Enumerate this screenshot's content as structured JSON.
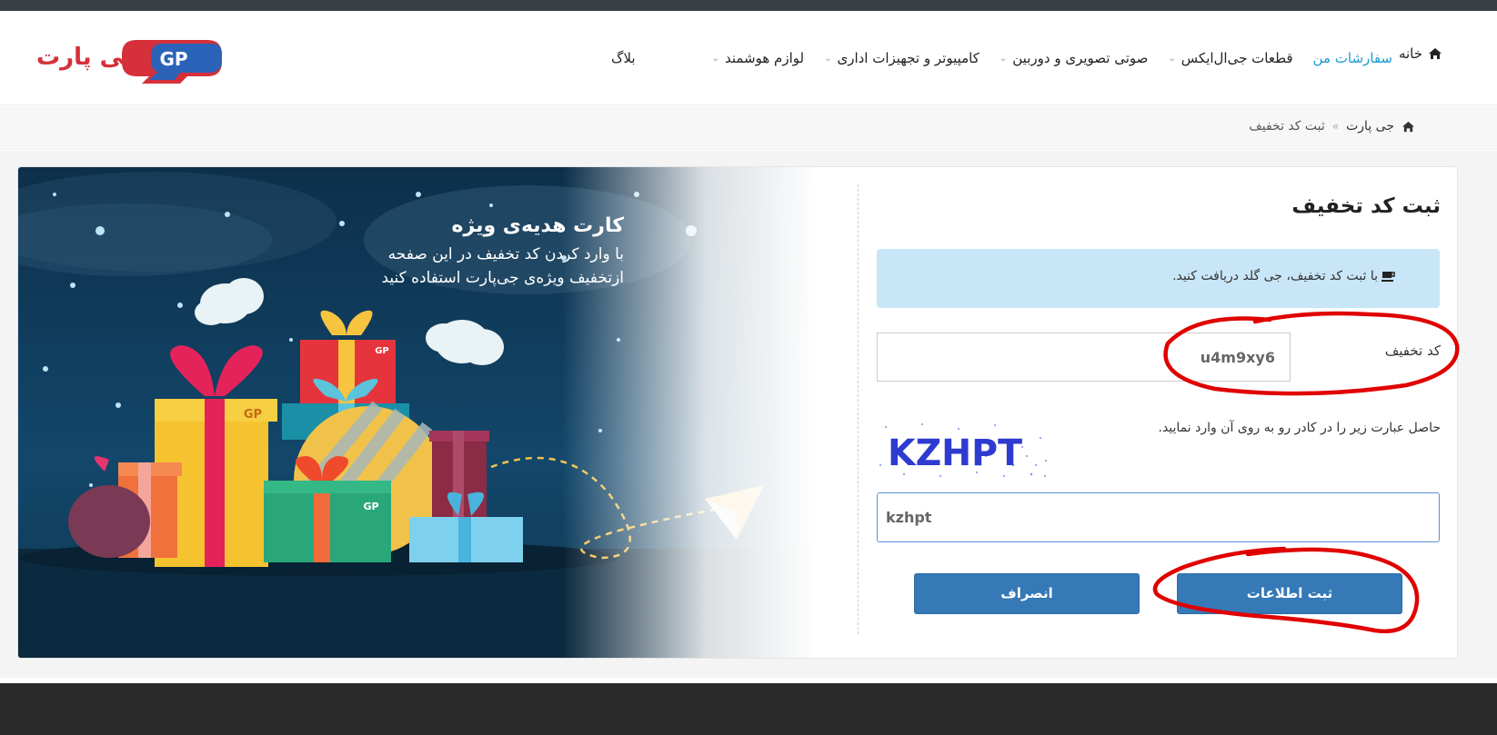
{
  "header": {
    "logo_text": "جی پارت",
    "logo_mark": "GP",
    "home_label": "خانه",
    "nav": [
      {
        "label": "بلاگ",
        "dropdown": false,
        "active": false
      },
      {
        "label": "لوازم هوشمند",
        "dropdown": true,
        "active": false
      },
      {
        "label": "کامپیوتر و تجهیزات اداری",
        "dropdown": true,
        "active": false
      },
      {
        "label": "صوتی تصویری و دوربین",
        "dropdown": true,
        "active": false
      },
      {
        "label": "قطعات جی‌ال‌ایکس",
        "dropdown": true,
        "active": false
      },
      {
        "label": "سفارشات من",
        "dropdown": false,
        "active": true
      }
    ]
  },
  "breadcrumb": {
    "home": "جی پارت",
    "current": "ثبت کد تخفیف"
  },
  "banner": {
    "title": "کارت هدیه‌ی ویژه",
    "line1": "با وارد کردن کد تخفیف در این صفحه",
    "line2": "ازتخفیف ویژه‌ی جی‌پارت استفاده کنید",
    "box_mark_1": "GP",
    "box_mark_2": "GP",
    "box_mark_3": "GP"
  },
  "form": {
    "title": "ثبت کد تخفیف",
    "info": "با ثبت کد تخفیف، جی گلد دریافت کنید.",
    "code_label": "کد تخفیف",
    "code_value": "u4m9xy6",
    "captcha_label": "حاصل عبارت زیر را در کادر رو به روی آن وارد نمایید.",
    "captcha_text": "KZHPT",
    "captcha_value": "kzhpt",
    "submit_label": "ثبت اطلاعات",
    "cancel_label": "انصراف"
  },
  "colors": {
    "accent": "#3579b7",
    "nav_active": "#1a9bd1",
    "info_bg": "#c8e6f7",
    "logo_red": "#d6303a",
    "logo_blue": "#2a63b8",
    "annotation_red": "#e00000"
  },
  "icons": {
    "home": "home-icon",
    "breadcrumb_home": "home-icon",
    "info": "coffee-cup-icon",
    "chevron": "chevron-down-icon"
  }
}
